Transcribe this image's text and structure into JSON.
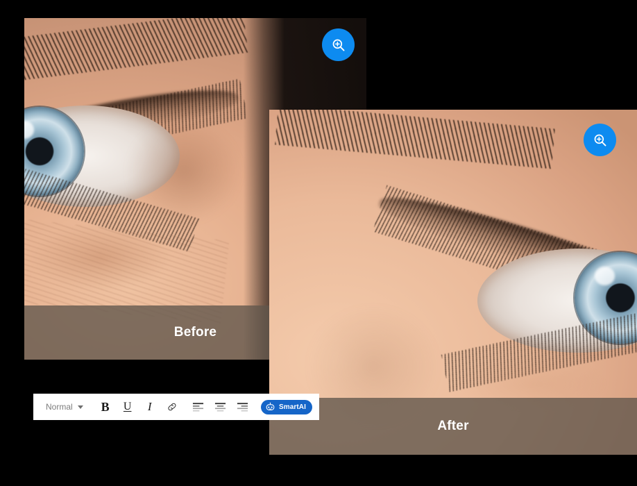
{
  "comparison": {
    "before": {
      "caption": "Before",
      "zoom_button": {
        "icon": "magnify-plus-icon",
        "color": "#0d8bf0"
      }
    },
    "after": {
      "caption": "After",
      "zoom_button": {
        "icon": "magnify-plus-icon",
        "color": "#0d8bf0"
      }
    },
    "caption_band_color": "#60564c",
    "caption_text_color": "#ffffff"
  },
  "toolbar": {
    "style_select": {
      "value": "Normal",
      "caret_icon": "chevron-down-icon"
    },
    "buttons": [
      {
        "name": "bold-button",
        "label": "B",
        "icon": "bold-icon"
      },
      {
        "name": "underline-button",
        "label": "U",
        "icon": "underline-icon"
      },
      {
        "name": "italic-button",
        "label": "I",
        "icon": "italic-icon"
      },
      {
        "name": "link-button",
        "label": "",
        "icon": "link-icon"
      },
      {
        "name": "align-left-button",
        "label": "",
        "icon": "align-left-icon"
      },
      {
        "name": "align-center-button",
        "label": "",
        "icon": "align-center-icon"
      },
      {
        "name": "align-right-button",
        "label": "",
        "icon": "align-right-icon"
      }
    ],
    "smartai": {
      "label": "SmartAI",
      "icon": "robot-icon",
      "background": "#1565c8",
      "text_color": "#ffffff"
    },
    "background": "#ffffff"
  },
  "page": {
    "background": "#000000"
  }
}
